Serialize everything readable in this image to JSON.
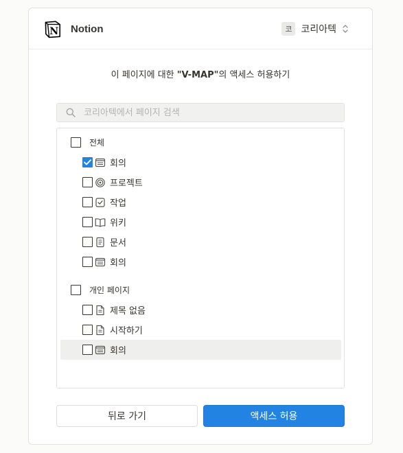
{
  "header": {
    "brand": "Notion",
    "workspace_initial": "코",
    "workspace_name": "코리아텍"
  },
  "prompt": {
    "prefix": "이 페이지에 대한 ",
    "target": "\"V-MAP\"",
    "suffix": "의 액세스 허용하기"
  },
  "search": {
    "placeholder": "코리아텍에서 페이지 검색",
    "value": ""
  },
  "tree": {
    "groups": [
      {
        "label": "전체",
        "checked": false,
        "items": [
          {
            "label": "회의",
            "icon": "meeting-list-icon",
            "checked": true
          },
          {
            "label": "프로젝트",
            "icon": "target-icon",
            "checked": false
          },
          {
            "label": "작업",
            "icon": "task-check-icon",
            "checked": false
          },
          {
            "label": "위키",
            "icon": "book-icon",
            "checked": false
          },
          {
            "label": "문서",
            "icon": "document-icon",
            "checked": false
          },
          {
            "label": "회의",
            "icon": "meeting-list-icon",
            "checked": false
          }
        ]
      },
      {
        "label": "개인 페이지",
        "checked": false,
        "items": [
          {
            "label": "제목 없음",
            "icon": "page-icon",
            "checked": false
          },
          {
            "label": "시작하기",
            "icon": "page-icon",
            "checked": false
          },
          {
            "label": "회의",
            "icon": "meeting-list-icon",
            "checked": false,
            "hovered": true
          }
        ]
      }
    ]
  },
  "buttons": {
    "back": "뒤로 가기",
    "allow": "액세스 허용"
  },
  "colors": {
    "accent": "#2383e2",
    "hover_row": "#efefed",
    "text": "#37352f"
  }
}
